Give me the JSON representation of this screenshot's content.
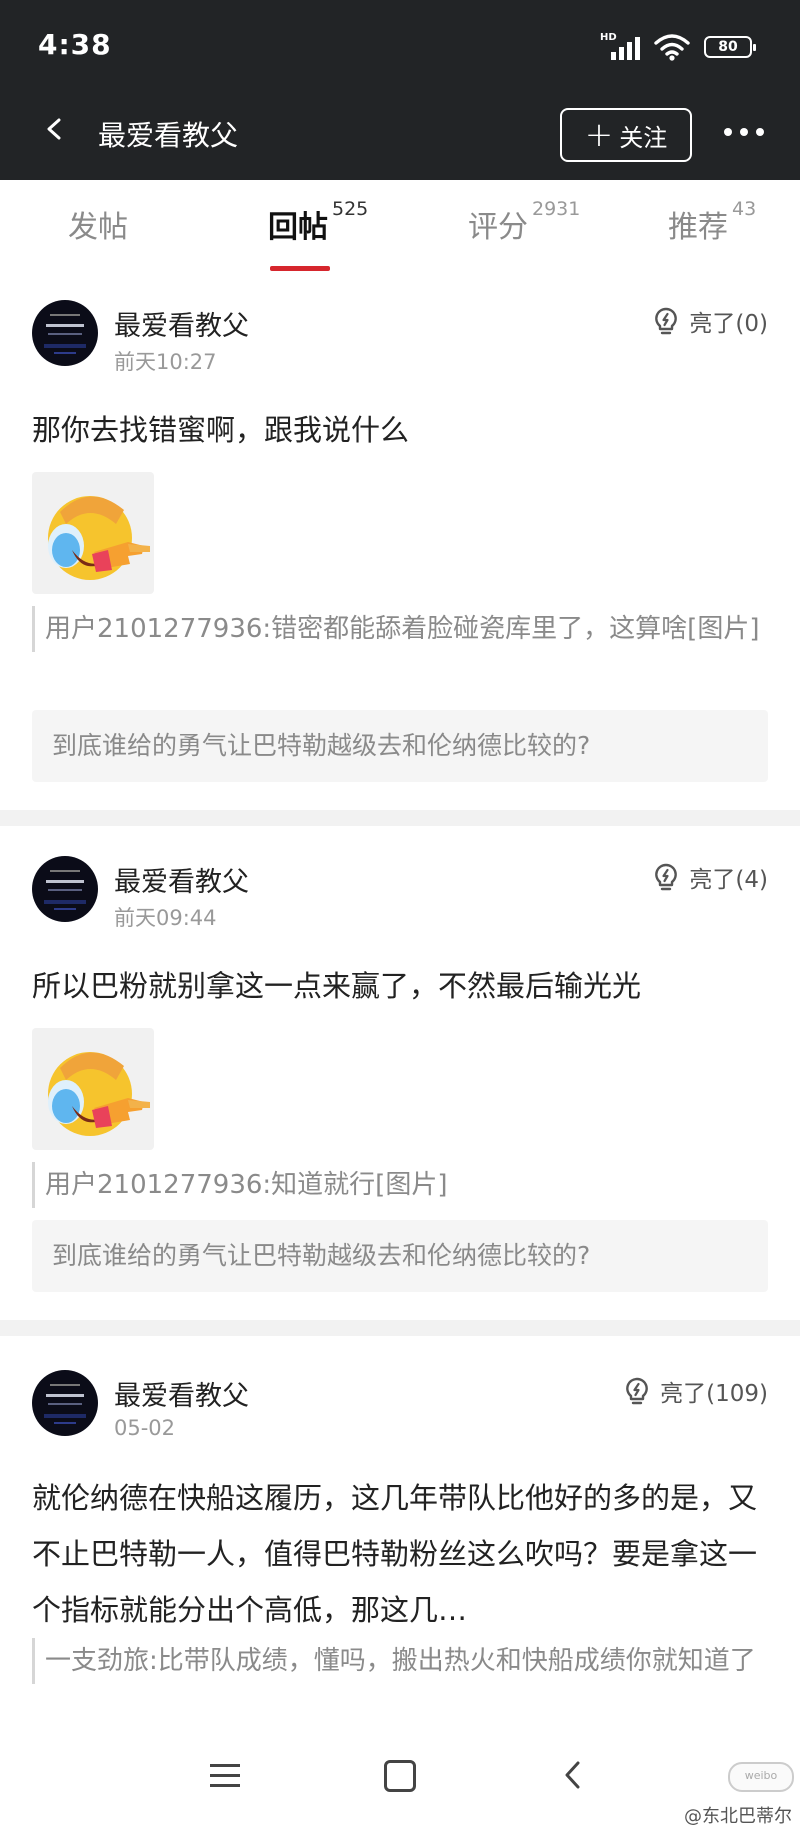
{
  "status_bar": {
    "time": "4:38",
    "network": "HD",
    "battery": "80"
  },
  "header": {
    "title": "最爱看教父",
    "follow_label": "关注"
  },
  "tabs": [
    {
      "label": "发帖",
      "count": ""
    },
    {
      "label": "回帖",
      "count": "525"
    },
    {
      "label": "评分",
      "count": "2931"
    },
    {
      "label": "推荐",
      "count": "43"
    }
  ],
  "posts": [
    {
      "username": "最爱看教父",
      "time": "前天10:27",
      "light": "亮了(0)",
      "text": "那你去找错蜜啊，跟我说什么",
      "quote": "用户2101277936:错密都能舔着脸碰瓷库里了，这算啥[图片]",
      "topic": "到底谁给的勇气让巴特勒越级去和伦纳德比较的?"
    },
    {
      "username": "最爱看教父",
      "time": "前天09:44",
      "light": "亮了(4)",
      "text": "所以巴粉就别拿这一点来赢了，不然最后输光光",
      "quote": "用户2101277936:知道就行[图片]",
      "topic": "到底谁给的勇气让巴特勒越级去和伦纳德比较的?"
    },
    {
      "username": "最爱看教父",
      "time": "05-02",
      "light": "亮了(109)",
      "text": "就伦纳德在快船这履历，这几年带队比他好的多的是，又不止巴特勒一人，值得巴特勒粉丝这么吹吗？要是拿这一个指标就能分出个高低，那这几…",
      "quote": "一支劲旅:比带队成绩，懂吗，搬出热火和快船成绩你就知道了"
    }
  ],
  "watermark": "@东北巴蒂尔",
  "watermark_logo": "weibo",
  "colors": {
    "header_bg": "#222426",
    "accent_red": "#d6262d",
    "separator": "#f2f2f2"
  },
  "icons": {
    "back": "chevron-left-icon",
    "more": "more-dots-icon",
    "light": "lightbulb-icon",
    "menu": "menu-icon",
    "home": "home-square-icon",
    "nav_back": "nav-back-icon"
  }
}
